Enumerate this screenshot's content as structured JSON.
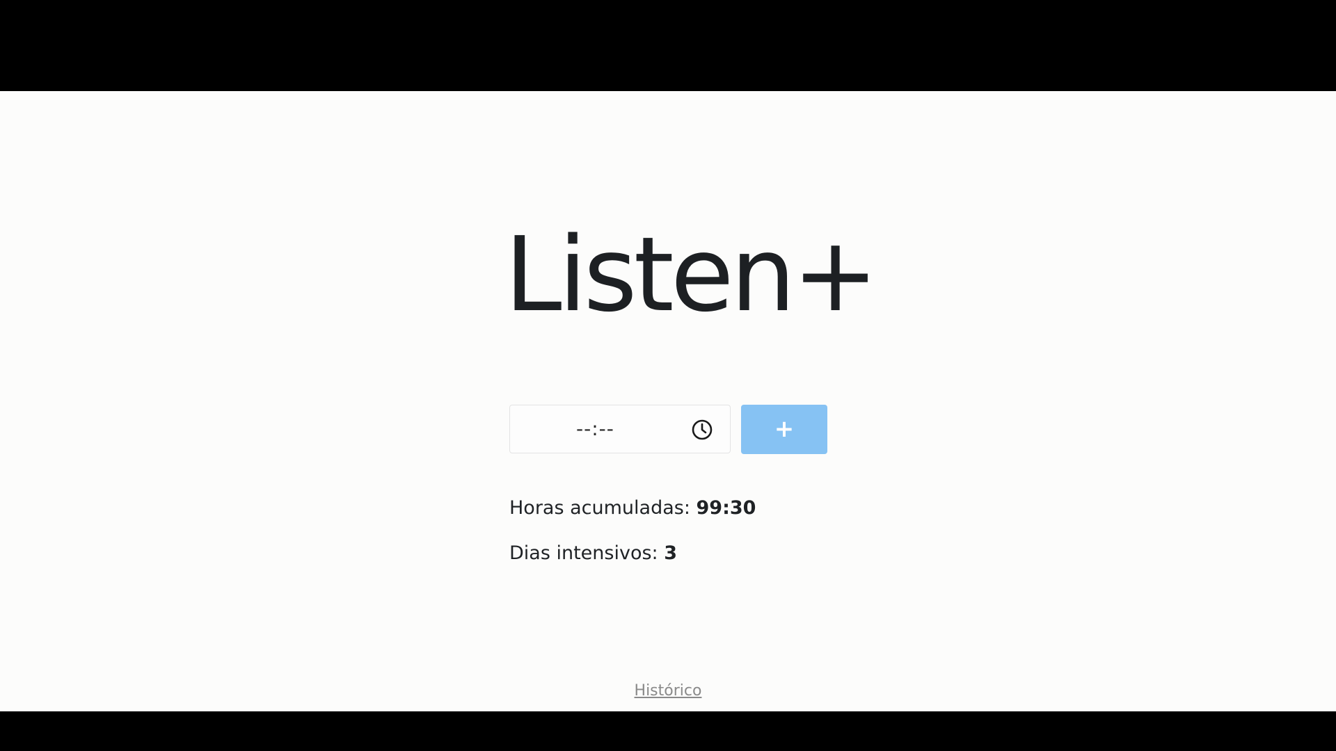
{
  "app": {
    "title": "Listen+"
  },
  "form": {
    "time_input_value": "--:--",
    "clock_icon": "clock-icon",
    "add_button_label": "+",
    "add_button_color": "#86c2f3"
  },
  "stats": {
    "hours_label": "Horas acumuladas: ",
    "hours_value": "99:30",
    "days_label": "Dias intensivos: ",
    "days_value": "3"
  },
  "footer": {
    "history_link": "Histórico"
  }
}
